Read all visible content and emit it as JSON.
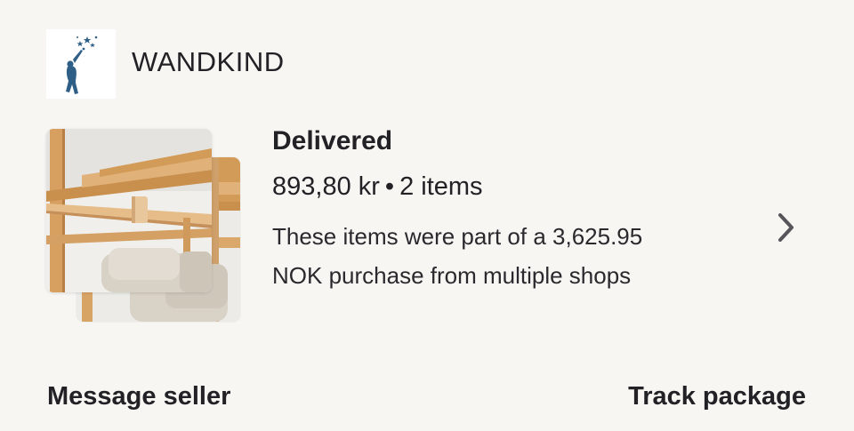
{
  "shop": {
    "logo_icon": "child-reaching-stars-icon",
    "name": "WANDKIND"
  },
  "order": {
    "status": "Delivered",
    "price": "893,80 kr",
    "separator": "•",
    "item_count": "2 items",
    "note": "These items were part of a 3,625.95 NOK purchase from multiple shops"
  },
  "thumbnails": [
    {
      "name": "wooden-rail-photo-front",
      "icon": "product-photo"
    },
    {
      "name": "wooden-rail-photo-back",
      "icon": "product-photo"
    }
  ],
  "navigation": {
    "chevron_icon": "chevron-right-icon"
  },
  "actions": {
    "message_seller": "Message seller",
    "track_package": "Track package"
  },
  "colors": {
    "background": "#f8f6f3",
    "text": "#222226",
    "logo_blue": "#2f5f86",
    "wood": "#d9a86a"
  }
}
